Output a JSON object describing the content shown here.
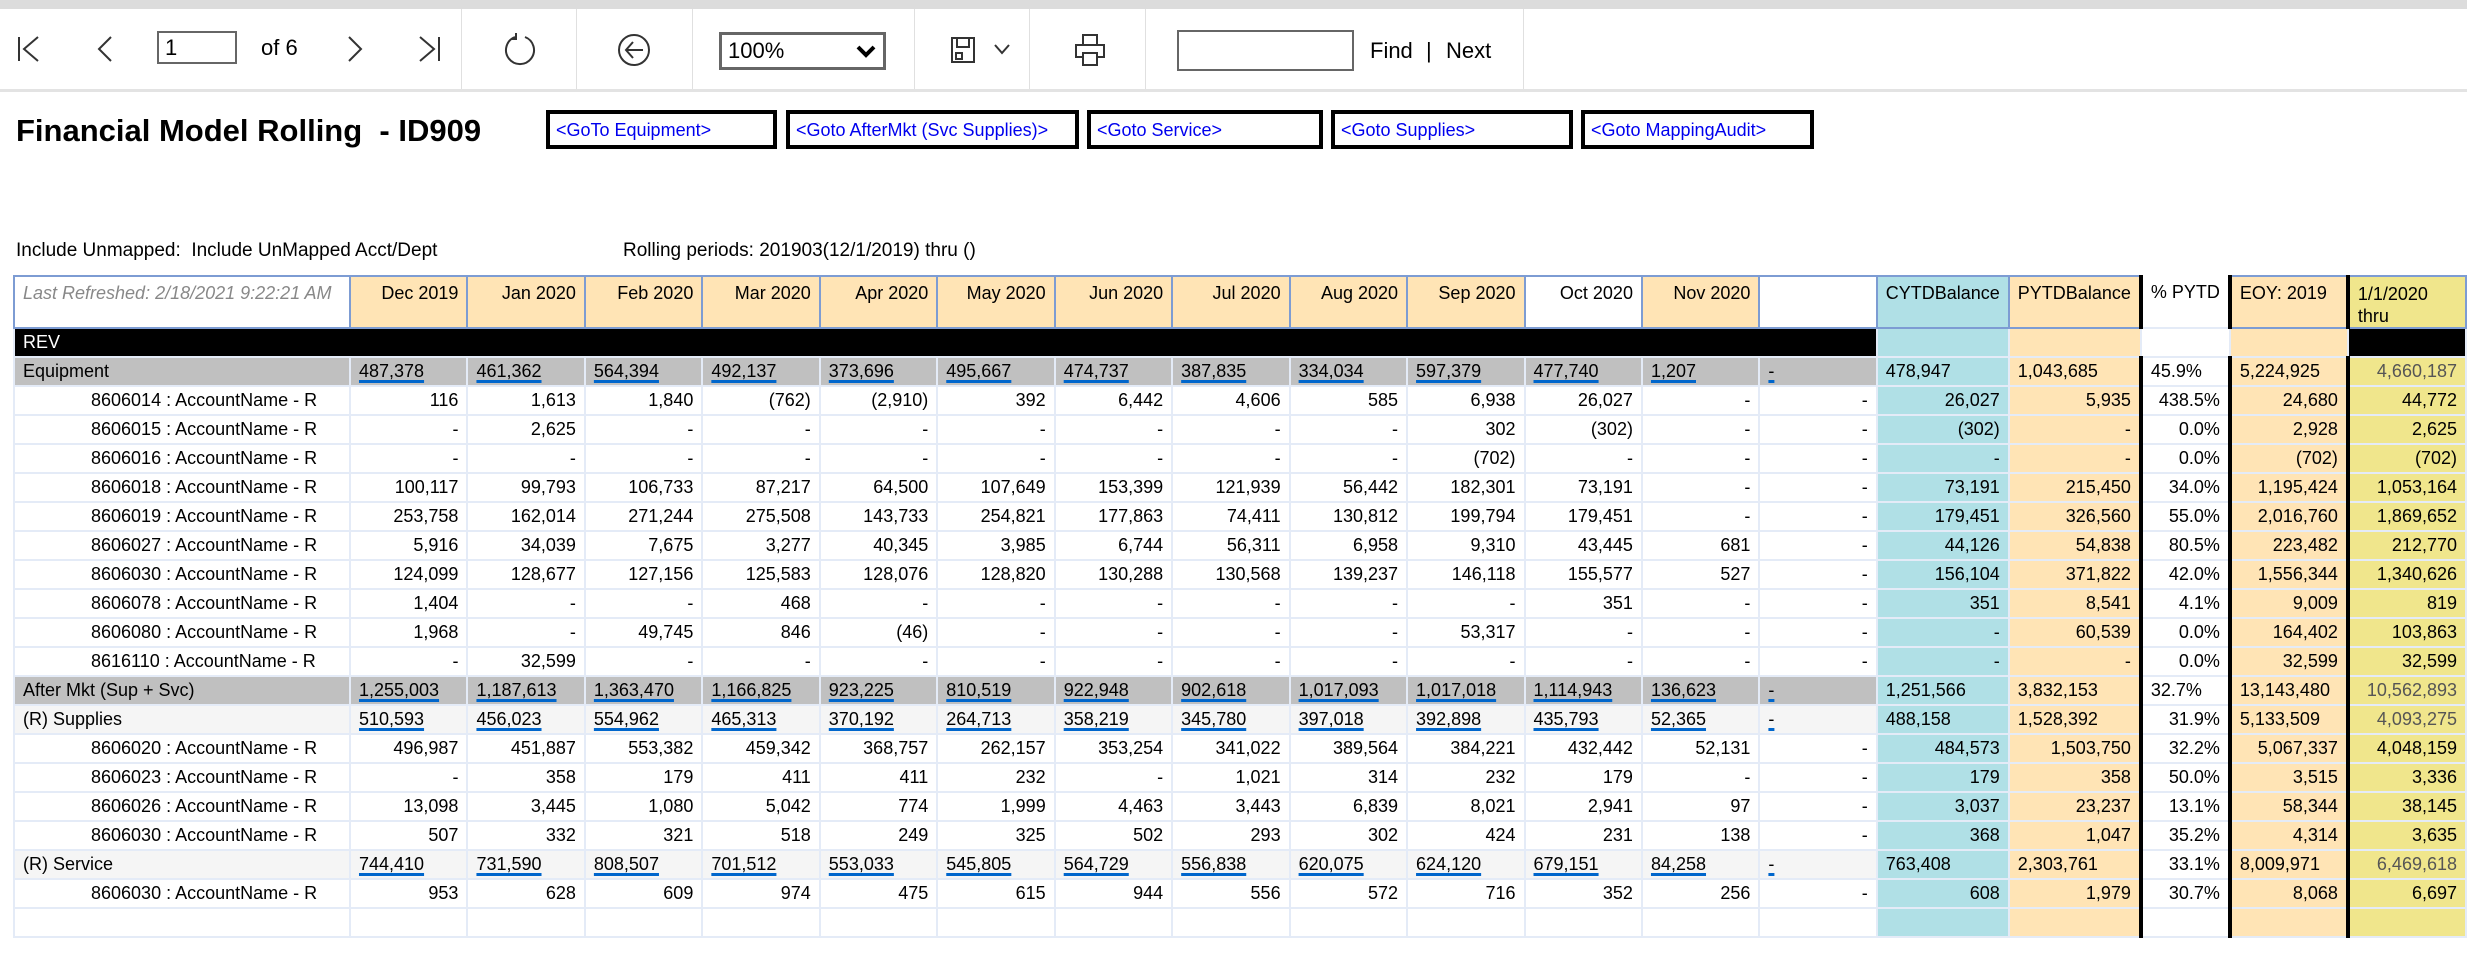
{
  "toolbar": {
    "page_current": "1",
    "page_of": "of 6",
    "zoom": "100%",
    "find_value": "",
    "find_label": "Find",
    "find_sep": "|",
    "next_label": "Next",
    "icons": [
      "first-page-icon",
      "previous-page-icon",
      "next-page-icon",
      "last-page-icon",
      "refresh-icon",
      "back-icon",
      "save-icon",
      "chevron-down-icon",
      "print-icon"
    ]
  },
  "report": {
    "title": "Financial Model Rolling  - ID909",
    "links": [
      "<GoTo Equipment>",
      "<Goto AfterMkt (Svc Supplies)>",
      "<Goto Service>",
      "<Goto Supplies>",
      "<Goto MappingAudit>"
    ],
    "filter_unmapped": "Include Unmapped:  Include UnMapped Acct/Dept",
    "rolling_periods": "Rolling periods: 201903(12/1/2019) thru ()"
  },
  "colors": {
    "peach": "#ffe4b5",
    "blue": "#b0e0e6",
    "yellow": "#f0e68c",
    "group_gray": "#c0c0c0",
    "link_underline": "#0066cc"
  },
  "table": {
    "last_refreshed": "Last Refreshed: 2/18/2021 9:22:21 AM",
    "months": [
      "Dec 2019",
      "Jan 2020",
      "Feb 2020",
      "Mar 2020",
      "Apr 2020",
      "May 2020",
      "Jun 2020",
      "Jul 2020",
      "Aug 2020",
      "Sep 2020",
      "Oct 2020",
      "Nov 2020",
      ""
    ],
    "summary_headers": {
      "cytd": "CYTDBalance",
      "pytd": "PYTDBalance",
      "pct": "% PYTD",
      "eoy": "EOY: 2019",
      "thru_line1": "1/1/2020",
      "thru_line2": "thru"
    },
    "rows": [
      {
        "type": "section",
        "label": "REV",
        "months": [],
        "cytd": "",
        "pytd": "",
        "pct": "",
        "eoy": "",
        "thru": ""
      },
      {
        "type": "group",
        "label": "Equipment",
        "months": [
          "487,378",
          "461,362",
          "564,394",
          "492,137",
          "373,696",
          "495,667",
          "474,737",
          "387,835",
          "334,034",
          "597,379",
          "477,740",
          "1,207",
          "-"
        ],
        "cytd": "478,947",
        "pytd": "1,043,685",
        "pct": "45.9%",
        "eoy": "5,224,925",
        "thru": "4,660,187"
      },
      {
        "type": "account",
        "label": "8606014 : AccountName - R",
        "months": [
          "116",
          "1,613",
          "1,840",
          "(762)",
          "(2,910)",
          "392",
          "6,442",
          "4,606",
          "585",
          "6,938",
          "26,027",
          "-",
          "-"
        ],
        "cytd": "26,027",
        "pytd": "5,935",
        "pct": "438.5%",
        "eoy": "24,680",
        "thru": "44,772"
      },
      {
        "type": "account",
        "label": "8606015 : AccountName - R",
        "months": [
          "-",
          "2,625",
          "-",
          "-",
          "-",
          "-",
          "-",
          "-",
          "-",
          "302",
          "(302)",
          "-",
          "-"
        ],
        "cytd": "(302)",
        "pytd": "-",
        "pct": "0.0%",
        "eoy": "2,928",
        "thru": "2,625"
      },
      {
        "type": "account",
        "label": "8606016 : AccountName - R",
        "months": [
          "-",
          "-",
          "-",
          "-",
          "-",
          "-",
          "-",
          "-",
          "-",
          "(702)",
          "-",
          "-",
          "-"
        ],
        "cytd": "-",
        "pytd": "-",
        "pct": "0.0%",
        "eoy": "(702)",
        "thru": "(702)"
      },
      {
        "type": "account",
        "label": "8606018 : AccountName - R",
        "months": [
          "100,117",
          "99,793",
          "106,733",
          "87,217",
          "64,500",
          "107,649",
          "153,399",
          "121,939",
          "56,442",
          "182,301",
          "73,191",
          "-",
          "-"
        ],
        "cytd": "73,191",
        "pytd": "215,450",
        "pct": "34.0%",
        "eoy": "1,195,424",
        "thru": "1,053,164"
      },
      {
        "type": "account",
        "label": "8606019 : AccountName - R",
        "months": [
          "253,758",
          "162,014",
          "271,244",
          "275,508",
          "143,733",
          "254,821",
          "177,863",
          "74,411",
          "130,812",
          "199,794",
          "179,451",
          "-",
          "-"
        ],
        "cytd": "179,451",
        "pytd": "326,560",
        "pct": "55.0%",
        "eoy": "2,016,760",
        "thru": "1,869,652"
      },
      {
        "type": "account",
        "label": "8606027 : AccountName - R",
        "months": [
          "5,916",
          "34,039",
          "7,675",
          "3,277",
          "40,345",
          "3,985",
          "6,744",
          "56,311",
          "6,958",
          "9,310",
          "43,445",
          "681",
          "-"
        ],
        "cytd": "44,126",
        "pytd": "54,838",
        "pct": "80.5%",
        "eoy": "223,482",
        "thru": "212,770"
      },
      {
        "type": "account",
        "label": "8606030 : AccountName - R",
        "months": [
          "124,099",
          "128,677",
          "127,156",
          "125,583",
          "128,076",
          "128,820",
          "130,288",
          "130,568",
          "139,237",
          "146,118",
          "155,577",
          "527",
          "-"
        ],
        "cytd": "156,104",
        "pytd": "371,822",
        "pct": "42.0%",
        "eoy": "1,556,344",
        "thru": "1,340,626"
      },
      {
        "type": "account",
        "label": "8606078 : AccountName - R",
        "months": [
          "1,404",
          "-",
          "-",
          "468",
          "-",
          "-",
          "-",
          "-",
          "-",
          "-",
          "351",
          "-",
          "-"
        ],
        "cytd": "351",
        "pytd": "8,541",
        "pct": "4.1%",
        "eoy": "9,009",
        "thru": "819"
      },
      {
        "type": "account",
        "label": "8606080 : AccountName - R",
        "months": [
          "1,968",
          "-",
          "49,745",
          "846",
          "(46)",
          "-",
          "-",
          "-",
          "-",
          "53,317",
          "-",
          "-",
          "-"
        ],
        "cytd": "-",
        "pytd": "60,539",
        "pct": "0.0%",
        "eoy": "164,402",
        "thru": "103,863"
      },
      {
        "type": "account",
        "label": "8616110 : AccountName - R",
        "months": [
          "-",
          "32,599",
          "-",
          "-",
          "-",
          "-",
          "-",
          "-",
          "-",
          "-",
          "-",
          "-",
          "-"
        ],
        "cytd": "-",
        "pytd": "-",
        "pct": "0.0%",
        "eoy": "32,599",
        "thru": "32,599"
      },
      {
        "type": "group",
        "label": "After Mkt (Sup + Svc)",
        "months": [
          "1,255,003",
          "1,187,613",
          "1,363,470",
          "1,166,825",
          "923,225",
          "810,519",
          "922,948",
          "902,618",
          "1,017,093",
          "1,017,018",
          "1,114,943",
          "136,623",
          "-"
        ],
        "cytd": "1,251,566",
        "pytd": "3,832,153",
        "pct": "32.7%",
        "eoy": "13,143,480",
        "thru": "10,562,893"
      },
      {
        "type": "subgroup",
        "label": "(R) Supplies",
        "months": [
          "510,593",
          "456,023",
          "554,962",
          "465,313",
          "370,192",
          "264,713",
          "358,219",
          "345,780",
          "397,018",
          "392,898",
          "435,793",
          "52,365",
          "-"
        ],
        "cytd": "488,158",
        "pytd": "1,528,392",
        "pct": "31.9%",
        "eoy": "5,133,509",
        "thru": "4,093,275"
      },
      {
        "type": "account",
        "label": "8606020 : AccountName - R",
        "months": [
          "496,987",
          "451,887",
          "553,382",
          "459,342",
          "368,757",
          "262,157",
          "353,254",
          "341,022",
          "389,564",
          "384,221",
          "432,442",
          "52,131",
          "-"
        ],
        "cytd": "484,573",
        "pytd": "1,503,750",
        "pct": "32.2%",
        "eoy": "5,067,337",
        "thru": "4,048,159"
      },
      {
        "type": "account",
        "label": "8606023 : AccountName - R",
        "months": [
          "-",
          "358",
          "179",
          "411",
          "411",
          "232",
          "-",
          "1,021",
          "314",
          "232",
          "179",
          "-",
          "-"
        ],
        "cytd": "179",
        "pytd": "358",
        "pct": "50.0%",
        "eoy": "3,515",
        "thru": "3,336"
      },
      {
        "type": "account",
        "label": "8606026 : AccountName - R",
        "months": [
          "13,098",
          "3,445",
          "1,080",
          "5,042",
          "774",
          "1,999",
          "4,463",
          "3,443",
          "6,839",
          "8,021",
          "2,941",
          "97",
          "-"
        ],
        "cytd": "3,037",
        "pytd": "23,237",
        "pct": "13.1%",
        "eoy": "58,344",
        "thru": "38,145"
      },
      {
        "type": "account",
        "label": "8606030 : AccountName - R",
        "months": [
          "507",
          "332",
          "321",
          "518",
          "249",
          "325",
          "502",
          "293",
          "302",
          "424",
          "231",
          "138",
          "-"
        ],
        "cytd": "368",
        "pytd": "1,047",
        "pct": "35.2%",
        "eoy": "4,314",
        "thru": "3,635"
      },
      {
        "type": "subgroup",
        "label": "(R) Service",
        "months": [
          "744,410",
          "731,590",
          "808,507",
          "701,512",
          "553,033",
          "545,805",
          "564,729",
          "556,838",
          "620,075",
          "624,120",
          "679,151",
          "84,258",
          "-"
        ],
        "cytd": "763,408",
        "pytd": "2,303,761",
        "pct": "33.1%",
        "eoy": "8,009,971",
        "thru": "6,469,618"
      },
      {
        "type": "account",
        "label": "8606030 : AccountName - R",
        "months": [
          "953",
          "628",
          "609",
          "974",
          "475",
          "615",
          "944",
          "556",
          "572",
          "716",
          "352",
          "256",
          "-"
        ],
        "cytd": "608",
        "pytd": "1,979",
        "pct": "30.7%",
        "eoy": "8,068",
        "thru": "6,697"
      },
      {
        "type": "account",
        "label": "",
        "months": [
          "",
          "",
          "",
          "",
          "",
          "",
          "",
          "",
          "",
          "",
          "",
          "",
          ""
        ],
        "cytd": "",
        "pytd": "",
        "pct": "",
        "eoy": "",
        "thru": ""
      }
    ]
  }
}
